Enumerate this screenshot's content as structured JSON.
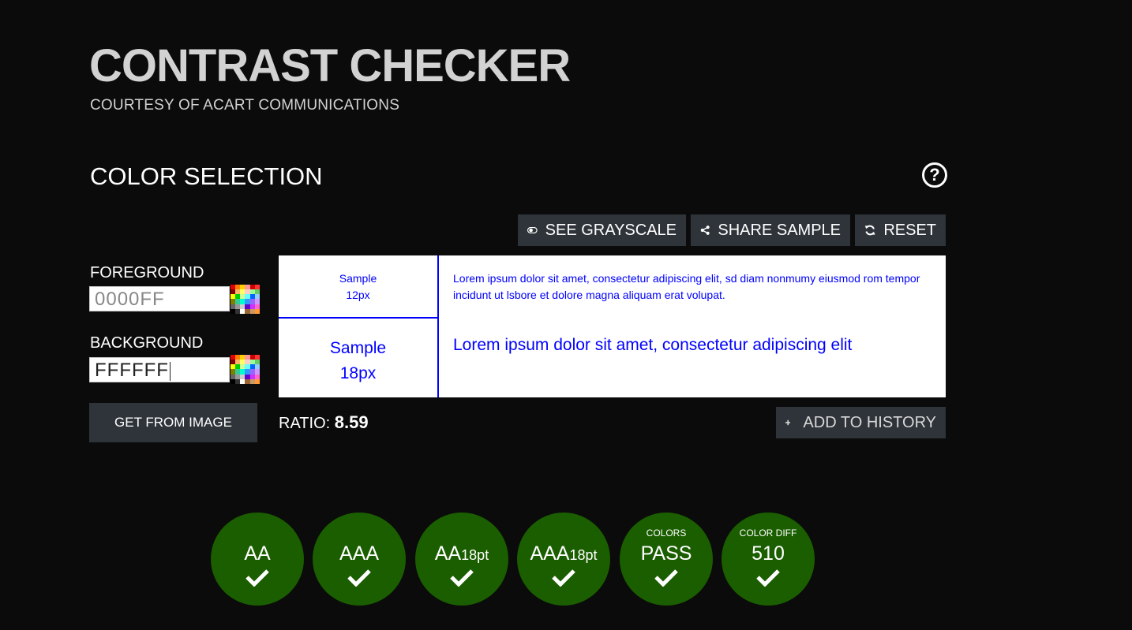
{
  "header": {
    "title": "CONTRAST CHECKER",
    "subtitle": "COURTESY OF ACART COMMUNICATIONS"
  },
  "section": {
    "title": "COLOR SELECTION",
    "help_icon": "question-circle-icon"
  },
  "toolbar": {
    "grayscale_label": "SEE GRAYSCALE",
    "share_label": "SHARE SAMPLE",
    "reset_label": "RESET"
  },
  "foreground": {
    "label": "FOREGROUND",
    "value": "",
    "placeholder": "0000FF"
  },
  "background": {
    "label": "BACKGROUND",
    "value": "FFFFFF"
  },
  "get_from_image_label": "GET FROM IMAGE",
  "samples": {
    "small_label_1": "Sample",
    "small_label_2": "12px",
    "small_text": "Lorem ipsum dolor sit amet, consectetur adipiscing elit, sd diam nonmumy eiusmod rom tempor incidunt ut lsbore et dolore magna aliquam erat volupat.",
    "large_label_1": "Sample",
    "large_label_2": "18px",
    "large_text": "Lorem ipsum dolor sit amet, consectetur adipiscing elit",
    "text_color": "#0000FF",
    "bg_color": "#FFFFFF"
  },
  "ratio": {
    "label": "RATIO:",
    "value": "8.59"
  },
  "add_history_label": "ADD TO HISTORY",
  "results": [
    {
      "top": "",
      "main": "AA",
      "sub": "",
      "status": "pass"
    },
    {
      "top": "",
      "main": "AAA",
      "sub": "",
      "status": "pass"
    },
    {
      "top": "",
      "main": "AA",
      "sub": "18pt",
      "status": "pass"
    },
    {
      "top": "",
      "main": "AAA",
      "sub": "18pt",
      "status": "pass"
    },
    {
      "top": "COLORS",
      "main": "PASS",
      "sub": "",
      "status": "pass"
    },
    {
      "top": "COLOR DIFF",
      "main": "510",
      "sub": "",
      "status": "pass"
    }
  ],
  "colors": {
    "badge_pass": "#1A5E00",
    "button_bg": "#2F343A",
    "page_bg": "#0B0B0B"
  }
}
